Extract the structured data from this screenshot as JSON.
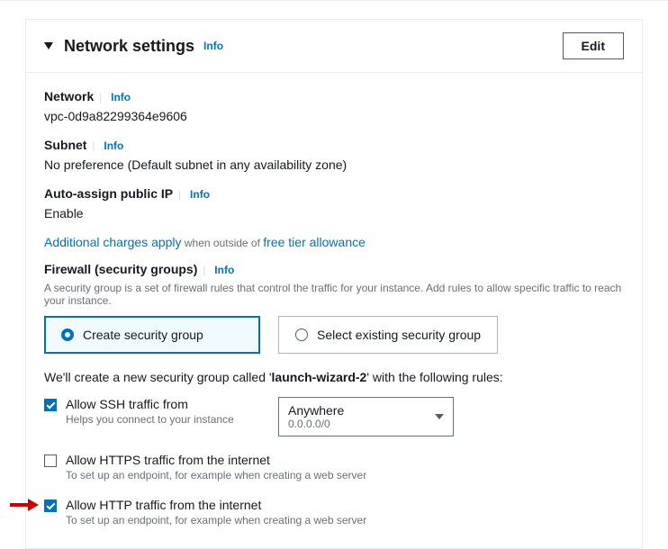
{
  "header": {
    "title": "Network settings",
    "info": "Info",
    "edit": "Edit"
  },
  "network": {
    "label": "Network",
    "info": "Info",
    "value": "vpc-0d9a82299364e9606"
  },
  "subnet": {
    "label": "Subnet",
    "info": "Info",
    "value": "No preference (Default subnet in any availability zone)"
  },
  "publicip": {
    "label": "Auto-assign public IP",
    "info": "Info",
    "value": "Enable"
  },
  "charges": {
    "link1": "Additional charges apply",
    "mid": " when outside of ",
    "link2": "free tier allowance"
  },
  "firewall": {
    "label": "Firewall (security groups)",
    "info": "Info",
    "help": "A security group is a set of firewall rules that control the traffic for your instance. Add rules to allow specific traffic to reach your instance."
  },
  "sgradio": {
    "create": "Create security group",
    "select": "Select existing security group"
  },
  "sgtext": {
    "pre": "We'll create a new security group called '",
    "name": "launch-wizard-2",
    "post": "' with the following rules:"
  },
  "ssh": {
    "label": "Allow SSH traffic from",
    "help": "Helps you connect to your instance",
    "dropdown_main": "Anywhere",
    "dropdown_sub": "0.0.0.0/0"
  },
  "https": {
    "label": "Allow HTTPS traffic from the internet",
    "help": "To set up an endpoint, for example when creating a web server"
  },
  "http": {
    "label": "Allow HTTP traffic from the internet",
    "help": "To set up an endpoint, for example when creating a web server"
  }
}
